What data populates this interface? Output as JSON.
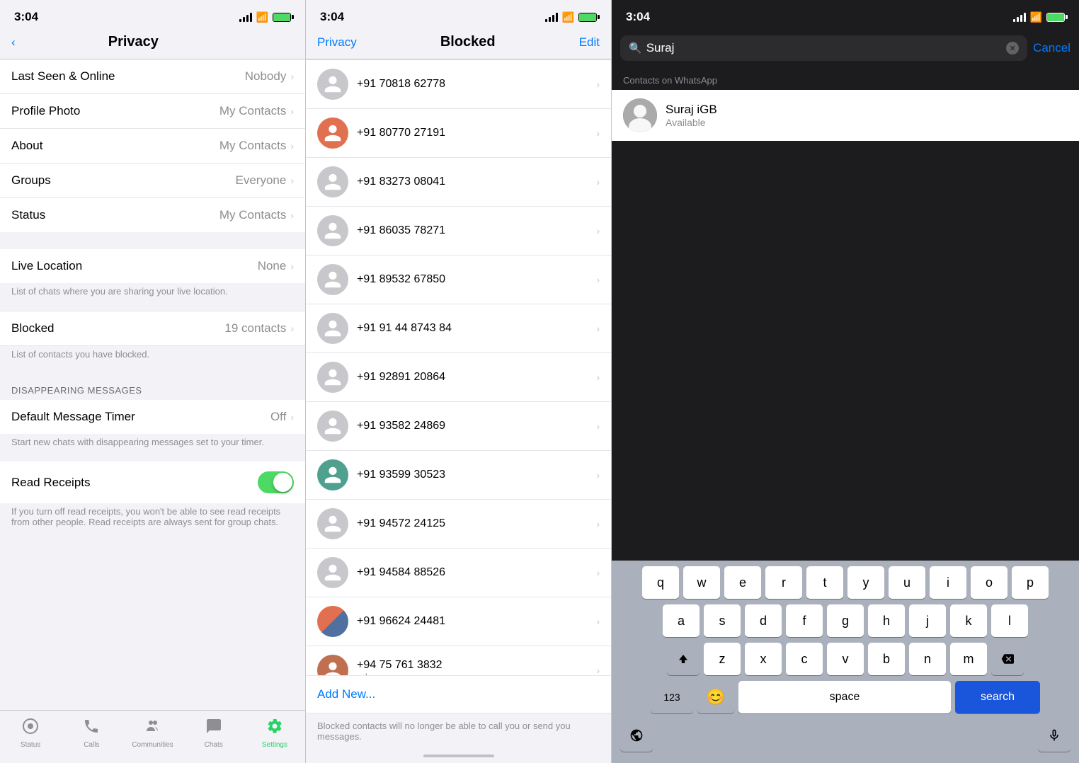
{
  "panel1": {
    "status_time": "3:04",
    "nav_title": "Privacy",
    "settings": [
      {
        "label": "Last Seen & Online",
        "value": "Nobody"
      },
      {
        "label": "Profile Photo",
        "value": "My Contacts"
      },
      {
        "label": "About",
        "value": "My Contacts"
      },
      {
        "label": "Groups",
        "value": "Everyone"
      },
      {
        "label": "Status",
        "value": "My Contacts"
      }
    ],
    "live_location_label": "Live Location",
    "live_location_value": "None",
    "live_location_sub": "List of chats where you are sharing your live location.",
    "blocked_label": "Blocked",
    "blocked_value": "19 contacts",
    "blocked_sub": "List of contacts you have blocked.",
    "section_disappearing": "DISAPPEARING MESSAGES",
    "timer_label": "Default Message Timer",
    "timer_value": "Off",
    "timer_sub": "Start new chats with disappearing messages set to your timer.",
    "receipts_label": "Read Receipts",
    "receipts_sub": "If you turn off read receipts, you won't be able to see read receipts from other people. Read receipts are always sent for group chats.",
    "tabs": [
      {
        "icon": "📷",
        "label": "Status"
      },
      {
        "icon": "📞",
        "label": "Calls"
      },
      {
        "icon": "👥",
        "label": "Communities"
      },
      {
        "icon": "💬",
        "label": "Chats"
      },
      {
        "icon": "⚙️",
        "label": "Settings",
        "active": true
      }
    ]
  },
  "panel2": {
    "status_time": "3:04",
    "nav_back": "Privacy",
    "nav_title": "Blocked",
    "nav_edit": "Edit",
    "contacts": [
      {
        "phone": "+91 70818 62778",
        "has_photo": false,
        "color": "gray"
      },
      {
        "phone": "+91 80770 27191",
        "has_photo": true,
        "color": "orange"
      },
      {
        "phone": "+91 83273 08041",
        "has_photo": false,
        "color": "gray"
      },
      {
        "phone": "+91 86035 78271",
        "has_photo": false,
        "color": "gray"
      },
      {
        "phone": "+91 89532 67850",
        "has_photo": false,
        "color": "gray"
      },
      {
        "phone": "+91 91 44 8743 84",
        "has_photo": false,
        "color": "gray"
      },
      {
        "phone": "+91 92891 20864",
        "has_photo": false,
        "color": "gray"
      },
      {
        "phone": "+91 93582 24869",
        "has_photo": false,
        "color": "gray"
      },
      {
        "phone": "+91 93599 30523",
        "has_photo": true,
        "color": "teal"
      },
      {
        "phone": "+91 94572 24125",
        "has_photo": false,
        "color": "gray"
      },
      {
        "phone": "+91 94584 88526",
        "has_photo": false,
        "color": "gray"
      },
      {
        "phone": "+91 96624 24481",
        "has_photo": true,
        "color": "striped"
      },
      {
        "phone": "+94 75 761 3832",
        "has_photo": true,
        "color": "orange2"
      }
    ],
    "add_new": "Add New...",
    "footer": "Blocked contacts will no longer be able to call you or send you messages."
  },
  "panel3": {
    "status_time": "3:04",
    "search_placeholder": "Suraj",
    "search_value": "Suraj",
    "cancel_label": "Cancel",
    "contacts_section": "Contacts on WhatsApp",
    "result_name": "Suraj iGB",
    "result_status": "Available",
    "keyboard": {
      "row1": [
        "q",
        "w",
        "e",
        "r",
        "t",
        "y",
        "u",
        "i",
        "o",
        "p"
      ],
      "row2": [
        "a",
        "s",
        "d",
        "f",
        "g",
        "h",
        "j",
        "k",
        "l"
      ],
      "row3": [
        "z",
        "x",
        "c",
        "v",
        "b",
        "n",
        "m"
      ],
      "numbers": "123",
      "emoji": "😊",
      "space": "space",
      "search": "search"
    }
  }
}
